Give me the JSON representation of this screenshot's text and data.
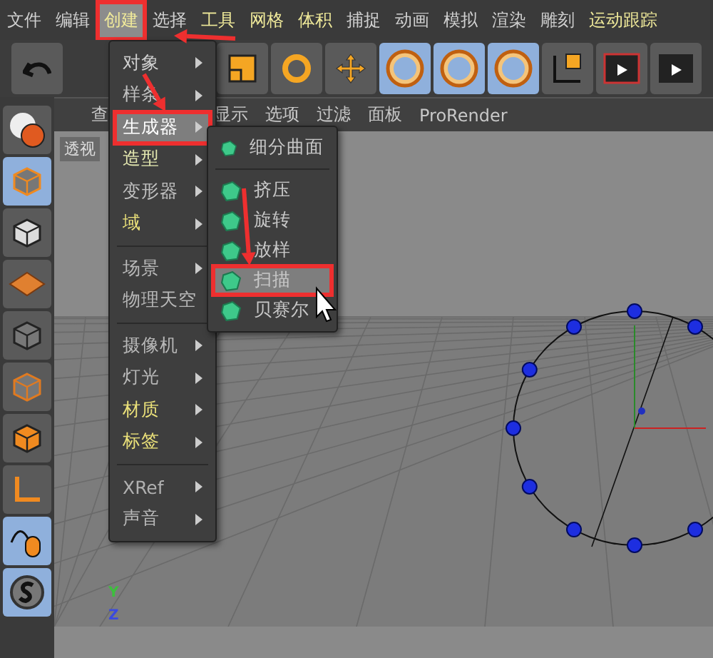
{
  "menubar": [
    {
      "label": "文件",
      "color": "#d0d0d0",
      "selected": false,
      "annotated": false
    },
    {
      "label": "编辑",
      "color": "#d0d0d0",
      "selected": false,
      "annotated": false
    },
    {
      "label": "创建",
      "color": "#f0ea9a",
      "selected": true,
      "annotated": true
    },
    {
      "label": "选择",
      "color": "#d0d0d0",
      "selected": false,
      "annotated": false
    },
    {
      "label": "工具",
      "color": "#f0ea9a",
      "selected": false,
      "annotated": false
    },
    {
      "label": "网格",
      "color": "#f0ea9a",
      "selected": false,
      "annotated": false
    },
    {
      "label": "体积",
      "color": "#f0ea9a",
      "selected": false,
      "annotated": false
    },
    {
      "label": "捕捉",
      "color": "#d0d0d0",
      "selected": false,
      "annotated": false
    },
    {
      "label": "动画",
      "color": "#d0d0d0",
      "selected": false,
      "annotated": false
    },
    {
      "label": "模拟",
      "color": "#d0d0d0",
      "selected": false,
      "annotated": false
    },
    {
      "label": "渲染",
      "color": "#d0d0d0",
      "selected": false,
      "annotated": false
    },
    {
      "label": "雕刻",
      "color": "#d0d0d0",
      "selected": false,
      "annotated": false
    },
    {
      "label": "运动跟踪",
      "color": "#f0ea9a",
      "selected": false,
      "annotated": false
    }
  ],
  "viewport_menu": [
    "查",
    "显示",
    "选项",
    "过滤",
    "面板",
    "ProRender"
  ],
  "viewport_label": "透视",
  "axis_labels": [
    "Y",
    "Z"
  ],
  "create_menu": [
    {
      "kind": "item",
      "label": "对象",
      "color": "#d0d0d0",
      "selected": false,
      "annotated": false
    },
    {
      "kind": "item",
      "label": "样条",
      "color": "#c0c0c0",
      "selected": false,
      "annotated": false
    },
    {
      "kind": "item",
      "label": "生成器",
      "color": "#ffffff",
      "selected": true,
      "annotated": true
    },
    {
      "kind": "item",
      "label": "造型",
      "color": "#e4e8b0",
      "selected": false,
      "annotated": false
    },
    {
      "kind": "item",
      "label": "变形器",
      "color": "#c0c0c0",
      "selected": false,
      "annotated": false
    },
    {
      "kind": "item",
      "label": "域",
      "color": "#ece27a",
      "selected": false,
      "annotated": false
    },
    {
      "kind": "separator"
    },
    {
      "kind": "item",
      "label": "场景",
      "color": "#b8b8b8",
      "selected": false,
      "annotated": false
    },
    {
      "kind": "item",
      "label": "物理天空",
      "color": "#b8b8b8",
      "selected": false,
      "annotated": false
    },
    {
      "kind": "separator"
    },
    {
      "kind": "item",
      "label": "摄像机",
      "color": "#b8b8b8",
      "selected": false,
      "annotated": false
    },
    {
      "kind": "item",
      "label": "灯光",
      "color": "#b8b8b8",
      "selected": false,
      "annotated": false
    },
    {
      "kind": "item",
      "label": "材质",
      "color": "#ece27a",
      "selected": false,
      "annotated": false
    },
    {
      "kind": "item",
      "label": "标签",
      "color": "#ece27a",
      "selected": false,
      "annotated": false
    },
    {
      "kind": "separator"
    },
    {
      "kind": "item",
      "label": "XRef",
      "color": "#b0b0b0",
      "selected": false,
      "annotated": false
    },
    {
      "kind": "item",
      "label": "声音",
      "color": "#b8b8b8",
      "selected": false,
      "annotated": false
    }
  ],
  "generator_menu": [
    {
      "kind": "item",
      "label": "细分曲面",
      "selected": false,
      "annotated": false
    },
    {
      "kind": "separator"
    },
    {
      "kind": "item",
      "label": "挤压",
      "selected": false,
      "annotated": false
    },
    {
      "kind": "item",
      "label": "旋转",
      "selected": false,
      "annotated": false
    },
    {
      "kind": "item",
      "label": "放样",
      "selected": false,
      "annotated": false
    },
    {
      "kind": "item",
      "label": "扫描",
      "selected": true,
      "annotated": true
    },
    {
      "kind": "item",
      "label": "贝赛尔",
      "selected": false,
      "annotated": false
    }
  ]
}
